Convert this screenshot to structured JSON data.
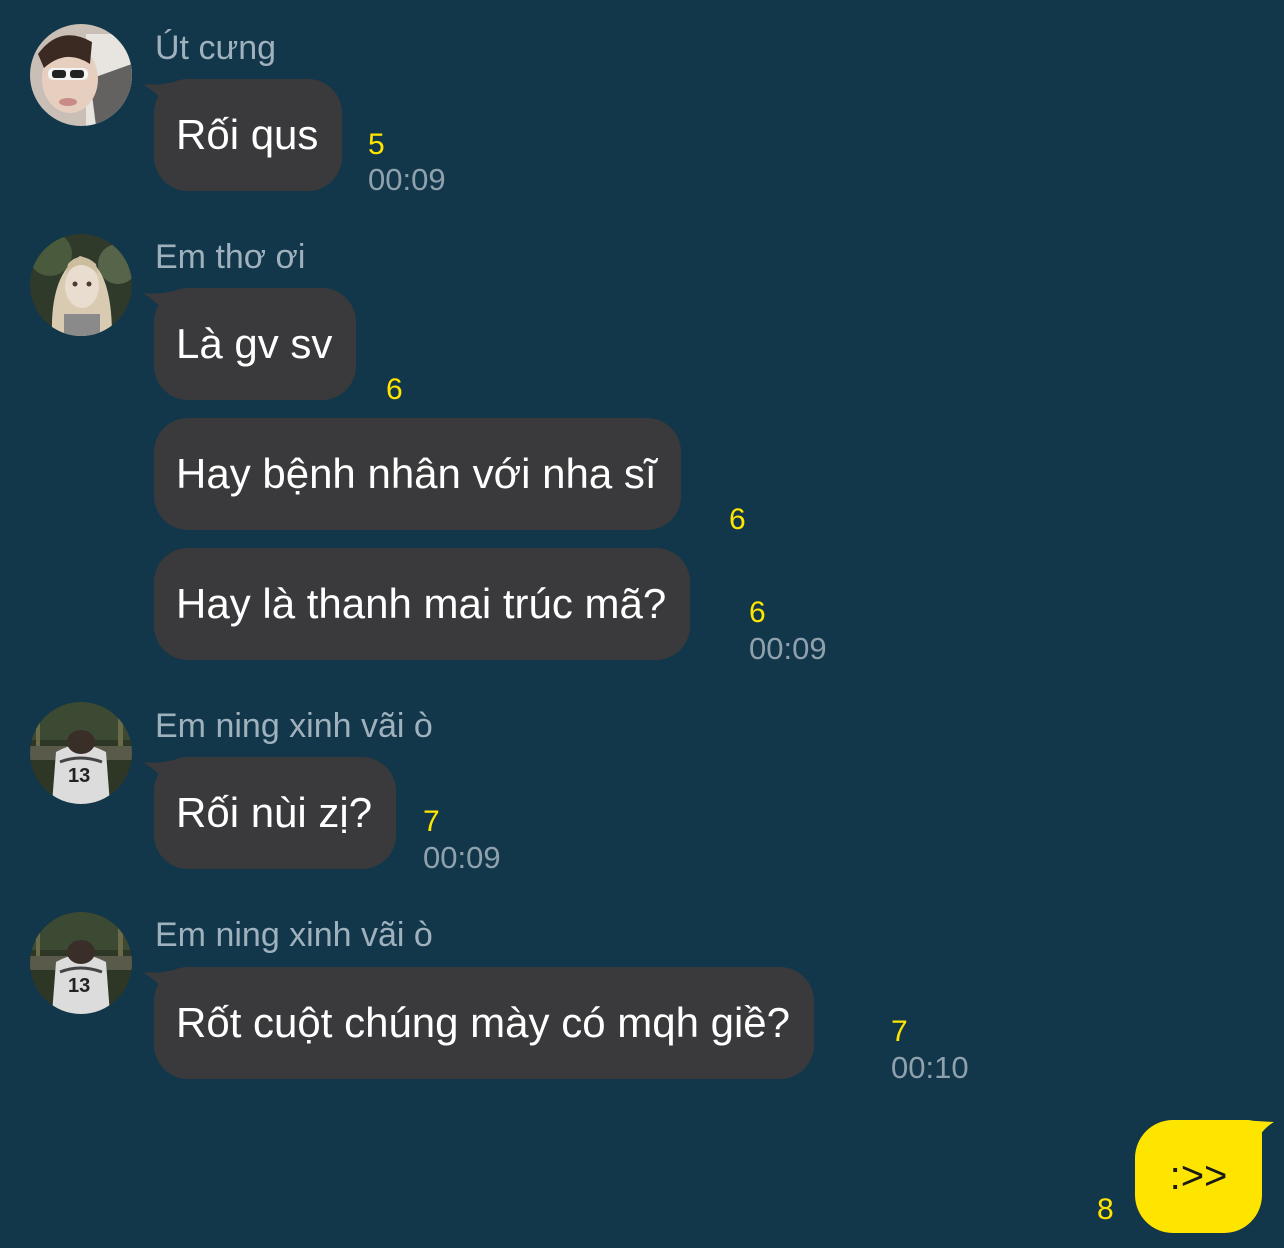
{
  "messages": [
    {
      "sender": "Út cưng",
      "avatar_icon": "avatar-girl-sunglasses-icon",
      "bubbles": [
        {
          "text": "Rối qus",
          "count": "5",
          "time": "00:09"
        }
      ]
    },
    {
      "sender": "Em thơ ơi",
      "avatar_icon": "avatar-blonde-girl-icon",
      "bubbles": [
        {
          "text": "Là gv sv",
          "count": "6"
        },
        {
          "text": "Hay bệnh nhân với nha sĩ",
          "count": "6"
        },
        {
          "text": "Hay là thanh mai trúc mã?",
          "count": "6",
          "time": "00:09"
        }
      ]
    },
    {
      "sender": "Em ning xinh vãi ò",
      "avatar_icon": "avatar-jersey-13-icon",
      "bubbles": [
        {
          "text": "Rối nùi zị?",
          "count": "7",
          "time": "00:09"
        }
      ]
    },
    {
      "sender": "Em ning xinh vãi ò",
      "avatar_icon": "avatar-jersey-13-icon",
      "bubbles": [
        {
          "text": "Rốt cuột chúng mày có mqh giề?",
          "count": "7",
          "time": "00:10"
        }
      ]
    }
  ],
  "my_message": {
    "text": ":>>",
    "count": "8"
  },
  "colors": {
    "background": "#12364a",
    "incoming_bubble": "#3a3a3c",
    "outgoing_bubble": "#fee500",
    "unread_count": "#ffe500",
    "timestamp": "#8fa1ad",
    "sender_name": "#9fb1bd"
  }
}
